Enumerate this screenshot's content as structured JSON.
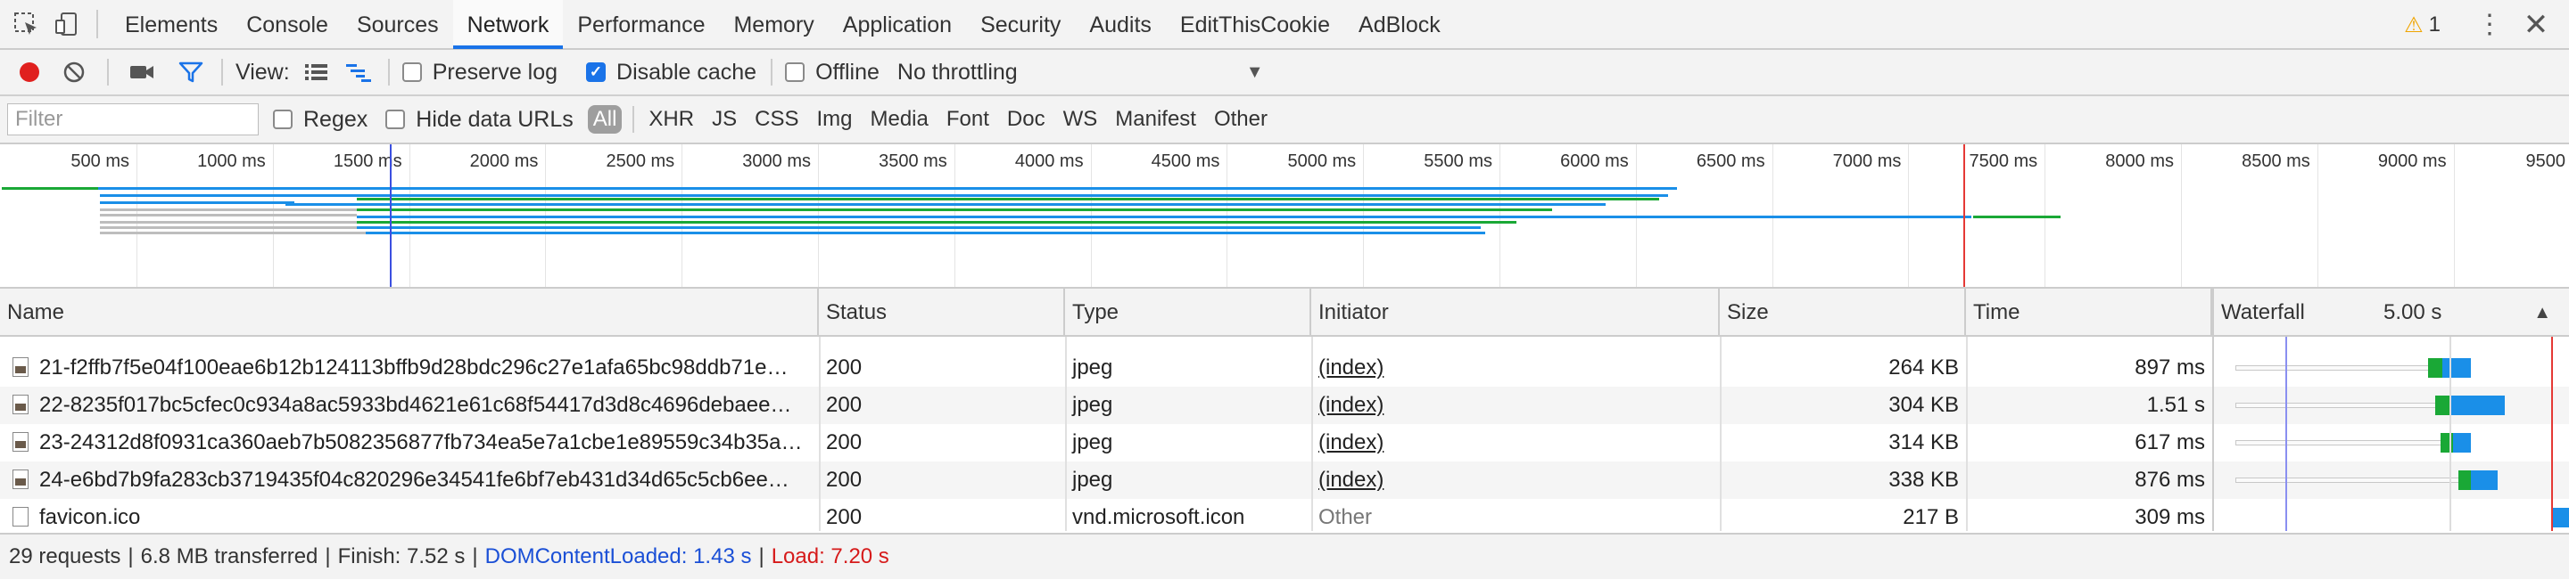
{
  "tabs": [
    {
      "label": "Elements",
      "active": false
    },
    {
      "label": "Console",
      "active": false
    },
    {
      "label": "Sources",
      "active": false
    },
    {
      "label": "Network",
      "active": true
    },
    {
      "label": "Performance",
      "active": false
    },
    {
      "label": "Memory",
      "active": false
    },
    {
      "label": "Application",
      "active": false
    },
    {
      "label": "Security",
      "active": false
    },
    {
      "label": "Audits",
      "active": false
    },
    {
      "label": "EditThisCookie",
      "active": false
    },
    {
      "label": "AdBlock",
      "active": false
    }
  ],
  "warnings": {
    "count": "1"
  },
  "toolbar": {
    "view_label": "View:",
    "preserve_log": {
      "label": "Preserve log",
      "checked": false
    },
    "disable_cache": {
      "label": "Disable cache",
      "checked": true
    },
    "offline": {
      "label": "Offline",
      "checked": false
    },
    "throttling": "No throttling"
  },
  "filter": {
    "placeholder": "Filter",
    "regex": "Regex",
    "hide_data_urls": "Hide data URLs",
    "types": [
      "All",
      "XHR",
      "JS",
      "CSS",
      "Img",
      "Media",
      "Font",
      "Doc",
      "WS",
      "Manifest",
      "Other"
    ],
    "selected": "All"
  },
  "overview": {
    "ticks": [
      "500 ms",
      "1000 ms",
      "1500 ms",
      "2000 ms",
      "2500 ms",
      "3000 ms",
      "3500 ms",
      "4000 ms",
      "4500 ms",
      "5000 ms",
      "5500 ms",
      "6000 ms",
      "6500 ms",
      "7000 ms",
      "7500 ms",
      "8000 ms",
      "8500 ms",
      "9000 ms",
      "9500"
    ],
    "dom_content_loaded_ms": 1430,
    "load_ms": 7200
  },
  "table": {
    "headers": {
      "name": "Name",
      "status": "Status",
      "type": "Type",
      "initiator": "Initiator",
      "size": "Size",
      "time": "Time",
      "waterfall": "Waterfall",
      "waterfall_scale": "5.00 s"
    },
    "rows": [
      {
        "name": "21-f2ffb7f5e04f100eae6b12b124113bffb9d28bdc296c27e1afa65bc98ddb71e…",
        "status": "200",
        "type": "jpeg",
        "initiator": "(index)",
        "size": "264 KB",
        "time": "897 ms",
        "icon": "image-file-icon"
      },
      {
        "name": "22-8235f017bc5cfec0c934a8ac5933bd4621e61c68f54417d3d8c4696debaee…",
        "status": "200",
        "type": "jpeg",
        "initiator": "(index)",
        "size": "304 KB",
        "time": "1.51 s",
        "icon": "image-file-icon"
      },
      {
        "name": "23-24312d8f0931ca360aeb7b5082356877fb734ea5e7a1cbe1e89559c34b35a…",
        "status": "200",
        "type": "jpeg",
        "initiator": "(index)",
        "size": "314 KB",
        "time": "617 ms",
        "icon": "image-file-icon"
      },
      {
        "name": "24-e6bd7b9fa283cb3719435f04c820296e34541fe6bf7eb431d34d65c5cb6ee…",
        "status": "200",
        "type": "jpeg",
        "initiator": "(index)",
        "size": "338 KB",
        "time": "876 ms",
        "icon": "image-file-icon"
      },
      {
        "name": "favicon.ico",
        "status": "200",
        "type": "vnd.microsoft.icon",
        "initiator": "Other",
        "size": "217 B",
        "time": "309 ms",
        "icon": "blank-file-icon"
      }
    ]
  },
  "status": {
    "requests": "29 requests",
    "transferred": "6.8 MB transferred",
    "finish": "Finish: 7.52 s",
    "dom_content_loaded": "DOMContentLoaded: 1.43 s",
    "load": "Load: 7.20 s"
  },
  "colors": {
    "accent": "#1a73e8",
    "record": "#e0201e",
    "waiting": "#1aa836",
    "receiving": "#1a8fe8",
    "load_line": "#e53935",
    "dcl_line": "#3b4fe0"
  }
}
